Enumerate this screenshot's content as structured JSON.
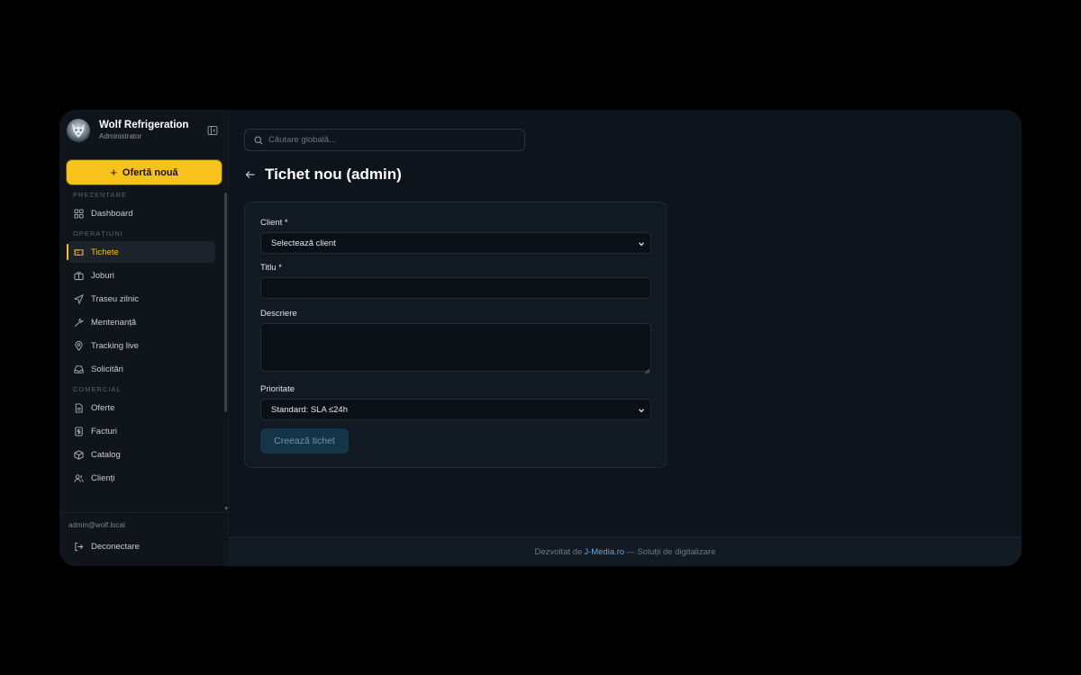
{
  "brand": {
    "name": "Wolf Refrigeration",
    "role": "Administrator"
  },
  "new_offer_label": "Ofertă nouă",
  "nav": {
    "sections": [
      {
        "label": "PREZENTARE",
        "items": [
          {
            "label": "Dashboard",
            "icon": "grid-icon"
          }
        ]
      },
      {
        "label": "OPERAȚIUNI",
        "items": [
          {
            "label": "Tichete",
            "icon": "ticket-icon",
            "active": true
          },
          {
            "label": "Joburi",
            "icon": "briefcase-icon"
          },
          {
            "label": "Traseu zilnic",
            "icon": "navigation-icon"
          },
          {
            "label": "Mentenanță",
            "icon": "wrench-icon"
          },
          {
            "label": "Tracking live",
            "icon": "map-pin-icon"
          },
          {
            "label": "Solicitări",
            "icon": "inbox-icon"
          }
        ]
      },
      {
        "label": "COMERCIAL",
        "items": [
          {
            "label": "Oferte",
            "icon": "file-text-icon"
          },
          {
            "label": "Facturi",
            "icon": "receipt-icon"
          },
          {
            "label": "Catalog",
            "icon": "package-icon"
          },
          {
            "label": "Clienți",
            "icon": "users-icon"
          }
        ]
      }
    ]
  },
  "user_email": "admin@wolf.local",
  "logout_label": "Deconectare",
  "search": {
    "placeholder": "Căutare globală..."
  },
  "page_title": "Tichet nou (admin)",
  "form": {
    "client_label": "Client *",
    "client_value": "Selectează client",
    "title_label": "Titlu *",
    "title_value": "",
    "description_label": "Descriere",
    "description_value": "",
    "priority_label": "Prioritate",
    "priority_value": "Standard: SLA ≤24h",
    "submit_label": "Creează tichet"
  },
  "footer": {
    "prefix": "Dezvoltat de",
    "brand": "J-Media.ro",
    "suffix": "— Soluții de digitalizare"
  },
  "colors": {
    "accent": "#f7c21e",
    "link": "#5aa9e6",
    "background": "#0e141b"
  }
}
